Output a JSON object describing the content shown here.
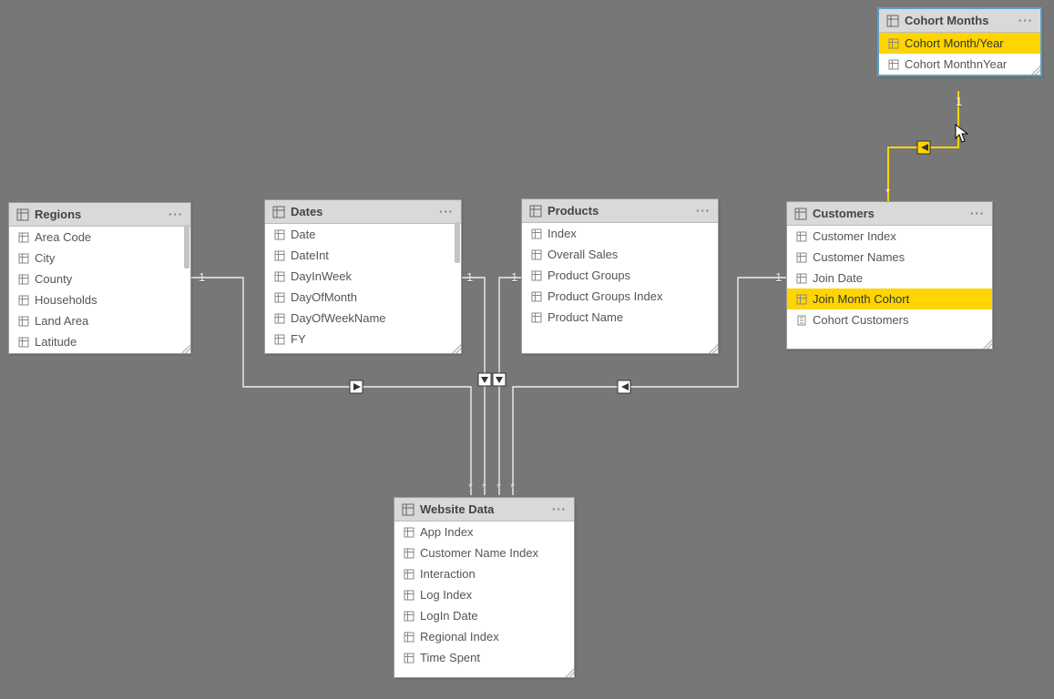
{
  "tables": {
    "cohort_months": {
      "title": "Cohort Months",
      "fields": [
        "Cohort Month/Year",
        "Cohort MonthnYear"
      ],
      "highlight_index": 0,
      "selected": true
    },
    "regions": {
      "title": "Regions",
      "fields": [
        "Area Code",
        "City",
        "County",
        "Households",
        "Land Area",
        "Latitude"
      ]
    },
    "dates": {
      "title": "Dates",
      "fields": [
        "Date",
        "DateInt",
        "DayInWeek",
        "DayOfMonth",
        "DayOfWeekName",
        "FY"
      ]
    },
    "products": {
      "title": "Products",
      "fields": [
        "Index",
        "Overall Sales",
        "Product Groups",
        "Product Groups Index",
        "Product Name"
      ]
    },
    "customers": {
      "title": "Customers",
      "fields": [
        "Customer Index",
        "Customer Names",
        "Join Date",
        "Join Month Cohort",
        "Cohort Customers"
      ],
      "highlight_index": 3
    },
    "website_data": {
      "title": "Website Data",
      "fields": [
        "App Index",
        "Customer Name Index",
        "Interaction",
        "Log Index",
        "LogIn Date",
        "Regional Index",
        "Time Spent"
      ]
    }
  },
  "cardinality": {
    "one": "1",
    "many": "*"
  },
  "menu_glyph": "···",
  "relationships": [
    {
      "from": "regions",
      "to": "website_data",
      "from_card": "1",
      "to_card": "*",
      "direction": "to"
    },
    {
      "from": "dates",
      "to": "website_data",
      "from_card": "1",
      "to_card": "*",
      "direction": "to"
    },
    {
      "from": "products",
      "to": "website_data",
      "from_card": "1",
      "to_card": "*",
      "direction": "to"
    },
    {
      "from": "customers",
      "to": "website_data",
      "from_card": "1",
      "to_card": "*",
      "direction": "to"
    },
    {
      "from": "cohort_months",
      "to": "customers",
      "from_card": "1",
      "to_card": "*",
      "direction": "to",
      "highlighted": true
    }
  ]
}
